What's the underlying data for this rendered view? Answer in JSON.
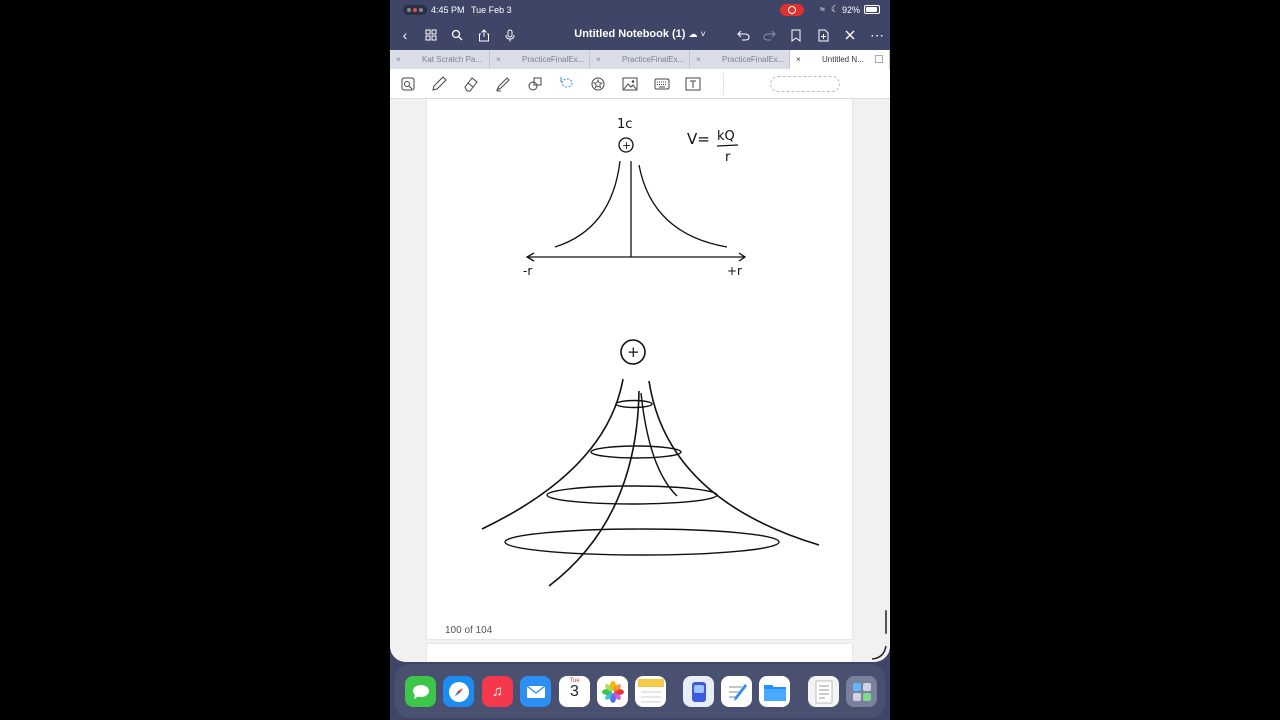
{
  "status_bar": {
    "time": "4:45 PM",
    "date": "Tue Feb 3",
    "battery": "92%"
  },
  "nav": {
    "title": "Untitled Notebook (1)",
    "cloud_glyph": "☁",
    "chevron": "˅"
  },
  "tabs": [
    {
      "label": "Kat Scratch Pa...",
      "close": "×",
      "active": false
    },
    {
      "label": "PracticeFinalEx...",
      "close": "×",
      "active": false
    },
    {
      "label": "PracticeFinalEx...",
      "close": "×",
      "active": false
    },
    {
      "label": "PracticeFinalEx...",
      "close": "×",
      "active": false
    },
    {
      "label": "Untitled N...",
      "close": "×",
      "active": true
    }
  ],
  "toolbar": {
    "tools": [
      "zoom-icon",
      "pen-icon",
      "eraser-icon",
      "highlighter-icon",
      "shapes-icon",
      "lasso-icon",
      "sticker-icon",
      "image-icon",
      "keyboard-icon",
      "text-icon"
    ]
  },
  "notes": {
    "charge_label_1": "1c",
    "charge_symbol": "+",
    "formula_lhs": "V=",
    "formula_num": "kQ",
    "formula_den": "r",
    "axis_left": "-r",
    "axis_right": "+r"
  },
  "page": {
    "counter": "100 of 104"
  },
  "dock": {
    "apps": [
      "messages-icon",
      "safari-icon",
      "music-icon",
      "mail-icon",
      "calendar-icon",
      "photos-icon",
      "notes-icon",
      "goodnotes-icon",
      "pencil-app-icon",
      "files-icon",
      "document-icon",
      "app-library-icon"
    ],
    "calendar_day": "Tue",
    "calendar_date": "3"
  }
}
